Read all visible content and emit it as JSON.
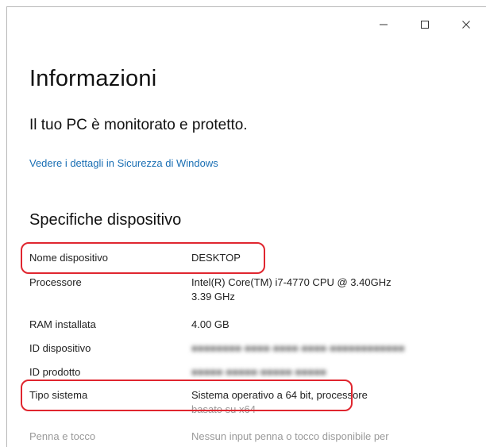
{
  "window": {
    "controls": {
      "minimize": "minimize-icon",
      "maximize": "maximize-icon",
      "close": "close-icon"
    }
  },
  "page": {
    "title": "Informazioni",
    "status": "Il tuo PC è monitorato e protetto.",
    "security_link": "Vedere i dettagli in Sicurezza di Windows"
  },
  "specs": {
    "title": "Specifiche dispositivo",
    "rows": [
      {
        "label": "Nome dispositivo",
        "value": "DESKTOP",
        "highlighted": true
      },
      {
        "label": "Processore",
        "value_line1": "Intel(R) Core(TM) i7-4770 CPU @ 3.40GHz",
        "value_line2": "3.39 GHz"
      },
      {
        "label": "RAM installata",
        "value": "4.00 GB"
      },
      {
        "label": "ID dispositivo",
        "value": "■■■■■■■■-■■■■-■■■■-■■■■-■■■■■■■■■■■■"
      },
      {
        "label": "ID prodotto",
        "value": "■■■■■-■■■■■-■■■■■-■■■■■"
      },
      {
        "label": "Tipo sistema",
        "value_line1": "Sistema operativo a 64 bit, processore",
        "value_line2": "basato su x64",
        "highlighted": true
      },
      {
        "label": "Penna e tocco",
        "value": "Nessun input penna o tocco disponibile per"
      }
    ]
  },
  "colors": {
    "link": "#1a6fb4",
    "highlight": "#e0262f"
  }
}
